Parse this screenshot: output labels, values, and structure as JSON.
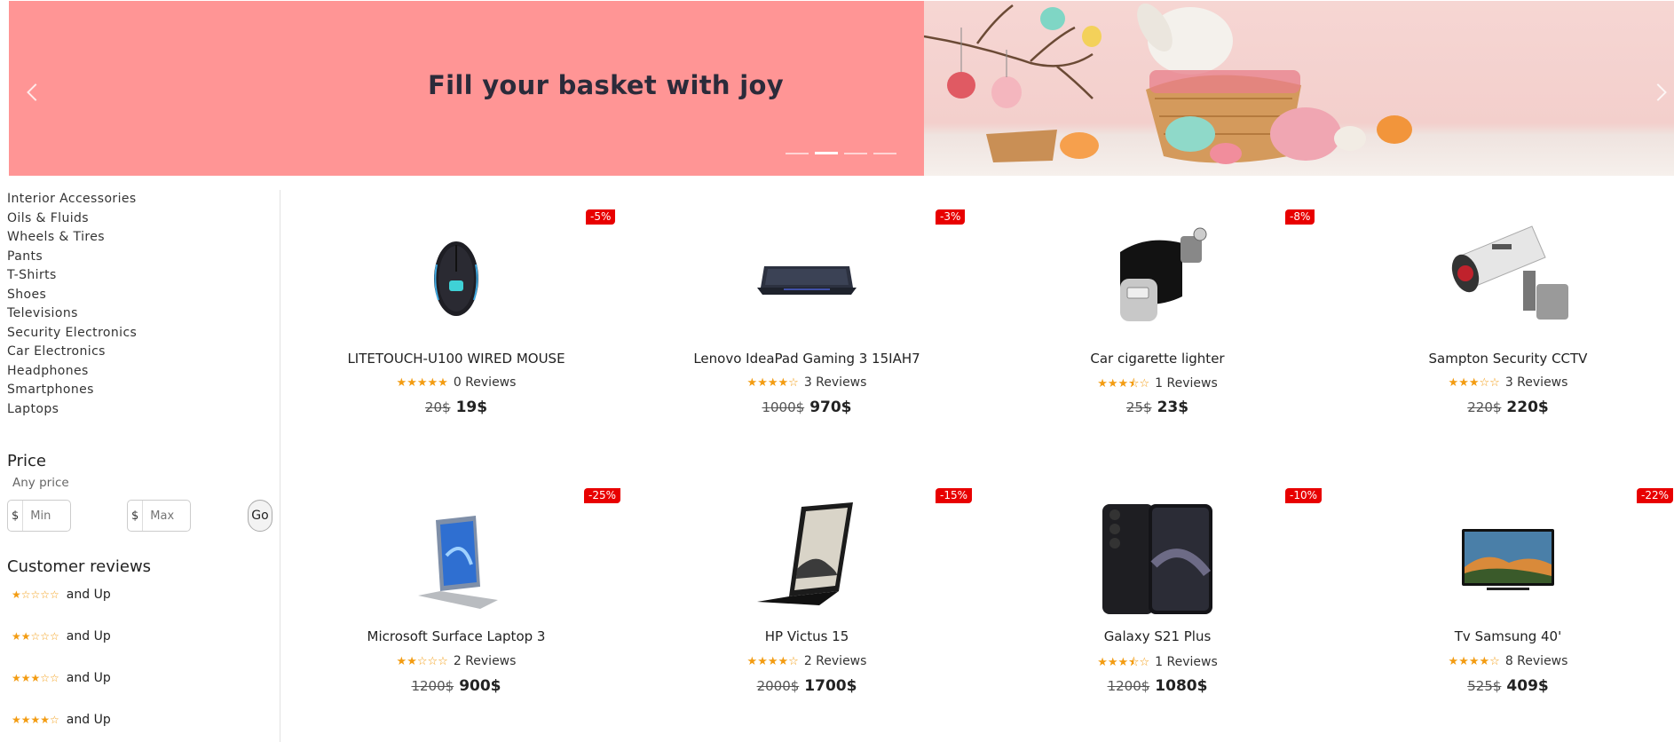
{
  "banner": {
    "title": "Fill your basket with joy",
    "slides_total": 4,
    "active_slide": 2
  },
  "sidebar": {
    "categories": [
      "Interior Accessories",
      "Oils & Fluids",
      "Wheels & Tires",
      "Pants",
      "T-Shirts",
      "Shoes",
      "Televisions",
      "Security Electronics",
      "Car Electronics",
      "Headphones",
      "Smartphones",
      "Laptops"
    ],
    "price_heading": "Price",
    "any_price": "Any price",
    "currency": "$",
    "min_placeholder": "Min",
    "max_placeholder": "Max",
    "go_label": "Go",
    "reviews_heading": "Customer reviews",
    "review_filters": [
      {
        "stars": "★☆☆☆☆",
        "label": "and Up"
      },
      {
        "stars": "★★☆☆☆",
        "label": "and Up"
      },
      {
        "stars": "★★★☆☆",
        "label": "and Up"
      },
      {
        "stars": "★★★★☆",
        "label": "and Up"
      }
    ]
  },
  "products": [
    {
      "name": "LITETOUCH-U100 WIRED MOUSE",
      "discount": "-5%",
      "stars": "★★★★★",
      "reviews": "0 Reviews",
      "old_price": "20$",
      "price": "19$",
      "image": "mouse-image"
    },
    {
      "name": "Lenovo IdeaPad Gaming 3 15IAH7",
      "discount": "-3%",
      "stars": "★★★★☆",
      "reviews": "3 Reviews",
      "old_price": "1000$",
      "price": "970$",
      "image": "laptop-image"
    },
    {
      "name": "Car cigarette lighter",
      "discount": "-8%",
      "stars": "★★★⯪☆",
      "reviews": "1 Reviews",
      "old_price": "25$",
      "price": "23$",
      "image": "car-lighter-image"
    },
    {
      "name": "Sampton Security CCTV",
      "discount": "",
      "stars": "★★★☆☆",
      "reviews": "3 Reviews",
      "old_price": "220$",
      "price": "220$",
      "image": "cctv-camera-image"
    },
    {
      "name": "Microsoft Surface Laptop 3",
      "discount": "-25%",
      "stars": "★★☆☆☆",
      "reviews": "2 Reviews",
      "old_price": "1200$",
      "price": "900$",
      "image": "surface-image"
    },
    {
      "name": "HP Victus 15",
      "discount": "-15%",
      "stars": "★★★★☆",
      "reviews": "2 Reviews",
      "old_price": "2000$",
      "price": "1700$",
      "image": "laptop-image"
    },
    {
      "name": "Galaxy S21 Plus",
      "discount": "-10%",
      "stars": "★★★⯪☆",
      "reviews": "1 Reviews",
      "old_price": "1200$",
      "price": "1080$",
      "image": "smartphone-image"
    },
    {
      "name": "Tv Samsung 40'",
      "discount": "-22%",
      "stars": "★★★★☆",
      "reviews": "8 Reviews",
      "old_price": "525$",
      "price": "409$",
      "image": "television-image"
    }
  ],
  "colors": {
    "banner_pink": "#ff9595",
    "badge_red": "#e80000",
    "star_orange": "#f39c12"
  }
}
